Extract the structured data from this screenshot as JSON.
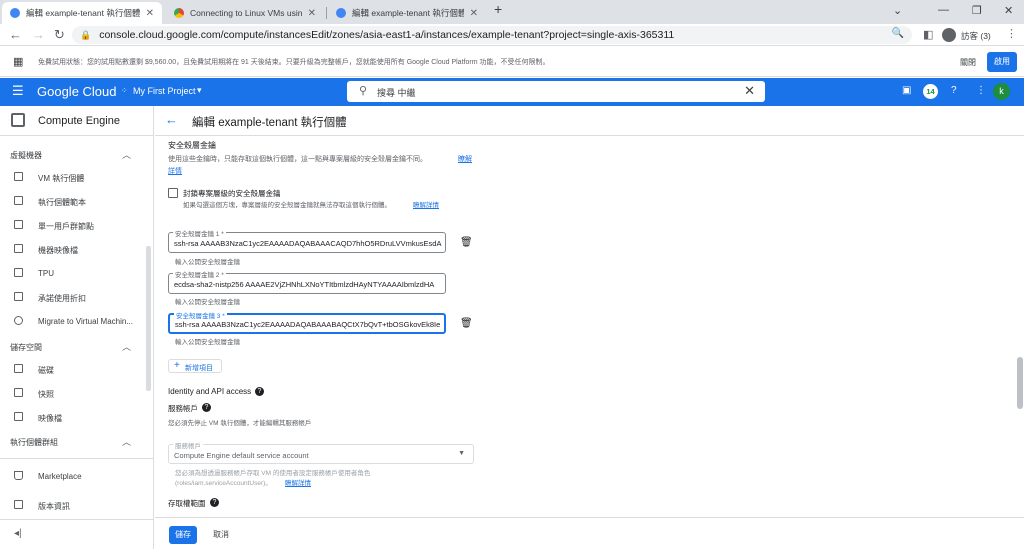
{
  "browser": {
    "tabs": [
      {
        "title": "編輯 example-tenant 執行個體...",
        "active": true
      },
      {
        "title": "Connecting to Linux VMs using",
        "active": false
      },
      {
        "title": "編輯 example-tenant 執行個體...",
        "active": false
      }
    ],
    "new_tab": "+",
    "url": "console.cloud.google.com/compute/instancesEdit/zones/asia-east1-a/instances/example-tenant?project=single-axis-365311",
    "profile_label": "訪客 (3)"
  },
  "trial_banner": {
    "message": "免費試用狀態：您的試用點數還剩 $9,560.00，且免費試用期將在 91 天後結束。只要升級為完整帳戶，您就能使用所有 Google Cloud Platform 功能，不受任何限制。",
    "dismiss_label": "關閉",
    "activate_label": "啟用"
  },
  "header": {
    "logo": "Google Cloud",
    "project": "My First Project",
    "search_placeholder": "搜尋  中繼",
    "notification_count": "14",
    "avatar_letter": "k"
  },
  "sidebar": {
    "product_name": "Compute Engine",
    "sections": [
      {
        "label": "虛擬機器",
        "items": [
          "VM 執行個體",
          "執行個體範本",
          "單一用戶群節點",
          "機器映像檔",
          "TPU",
          "承諾使用折扣",
          "Migrate to Virtual Machin..."
        ]
      },
      {
        "label": "儲存空間",
        "items": [
          "磁碟",
          "快照",
          "映像檔"
        ]
      },
      {
        "label": "執行個體群組",
        "items": []
      }
    ],
    "footer_items": [
      "Marketplace",
      "版本資訊"
    ]
  },
  "main": {
    "title": "編輯 example-tenant 執行個體",
    "security_keys_heading": "安全殼層金鑰",
    "security_keys_desc": "使用這些金鑰時，只能存取這個執行個體，這一點與專案層級的安全殼層金鑰不同。",
    "learn_more": "瞭解",
    "learn_more_2": "詳情",
    "block_project_keys_label": "封鎖專案層級的安全殼層金鑰",
    "block_project_keys_desc": "如果勾選這個方塊，專案層級的安全殼層金鑰就無法存取這個執行個體。",
    "block_learn_more": "瞭解詳情",
    "keys": [
      {
        "label": "安全殼層金鑰 1 *",
        "value": "ssh-rsa AAAAB3NzaC1yc2EAAAADAQABAAACAQD7hhO5RDruLVVmkusEsdA",
        "hint": "輸入公開安全殼層金鑰"
      },
      {
        "label": "安全殼層金鑰 2 *",
        "value": "ecdsa-sha2-nistp256 AAAAE2VjZHNhLXNoYTItbmlzdHAyNTYAAAAIbmlzdHA",
        "hint": "輸入公開安全殼層金鑰"
      },
      {
        "label": "安全殼層金鑰 3 *",
        "value": "ssh-rsa AAAAB3NzaC1yc2EAAAADAQABAAABAQCtX7bQvT+tbOSGkovEk8Ie",
        "hint": "輸入公開安全殼層金鑰"
      }
    ],
    "add_item": "新增項目",
    "identity_heading": "Identity and API access",
    "service_account_heading": "服務帳戶",
    "service_account_note": "您必須先停止 VM 執行個體，才能編輯其服務帳戶",
    "service_account_label": "服務帳戶",
    "service_account_value": "Compute Engine default service account",
    "service_account_desc_1": "您必須為想透過服務帳戶存取 VM 的使用者設定服務帳戶使用者角色",
    "service_account_desc_2": "(roles/iam.serviceAccountUser)。",
    "service_account_learn": "瞭解詳情",
    "access_scope_heading": "存取權範圍",
    "save_label": "儲存",
    "cancel_label": "取消"
  }
}
